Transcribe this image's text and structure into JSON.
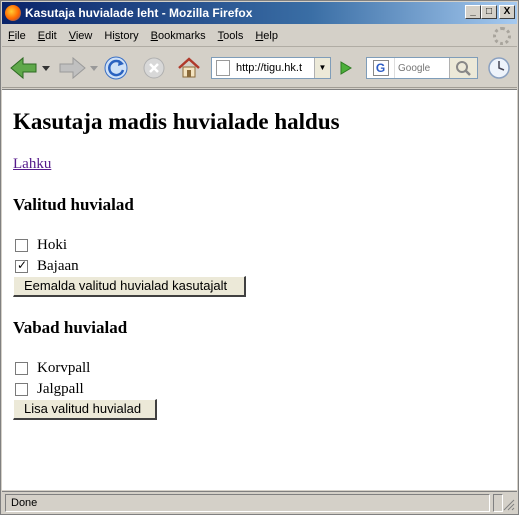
{
  "window": {
    "title": "Kasutaja huvialade leht - Mozilla Firefox",
    "controls": {
      "minimize": "_",
      "maximize": "□",
      "close": "X"
    }
  },
  "menu": [
    {
      "accel": "F",
      "rest": "ile"
    },
    {
      "accel": "E",
      "rest": "dit"
    },
    {
      "accel": "V",
      "rest": "iew"
    },
    {
      "accel": "",
      "pre": "Hi",
      "accel2": "s",
      "rest": "tory"
    },
    {
      "accel": "B",
      "rest": "ookmarks"
    },
    {
      "accel": "T",
      "rest": "ools"
    },
    {
      "accel": "H",
      "rest": "elp"
    }
  ],
  "toolbar": {
    "url": "http://tigu.hk.t",
    "search_placeholder": "Google",
    "icons": [
      "back-icon",
      "forward-icon",
      "reload-icon",
      "stop-icon",
      "home-icon",
      "go-icon",
      "google-icon",
      "search-icon",
      "clock-icon"
    ]
  },
  "page": {
    "title": "Kasutaja madis huvialade haldus",
    "logout": "Lahku",
    "selected_heading": "Valitud huvialad",
    "selected": [
      {
        "label": "Hoki",
        "checked": false
      },
      {
        "label": "Bajaan",
        "checked": true
      }
    ],
    "remove_button": "Eemalda valitud huvialad kasutajalt",
    "free_heading": "Vabad huvialad",
    "free": [
      {
        "label": "Korvpall",
        "checked": false
      },
      {
        "label": "Jalgpall",
        "checked": false
      }
    ],
    "add_button": "Lisa valitud huvialad"
  },
  "status": {
    "text": "Done"
  },
  "colors": {
    "titlebar_start": "#0a246a",
    "titlebar_end": "#a6caf0",
    "chrome": "#d4d0c8",
    "visited_link": "#551a8b"
  }
}
